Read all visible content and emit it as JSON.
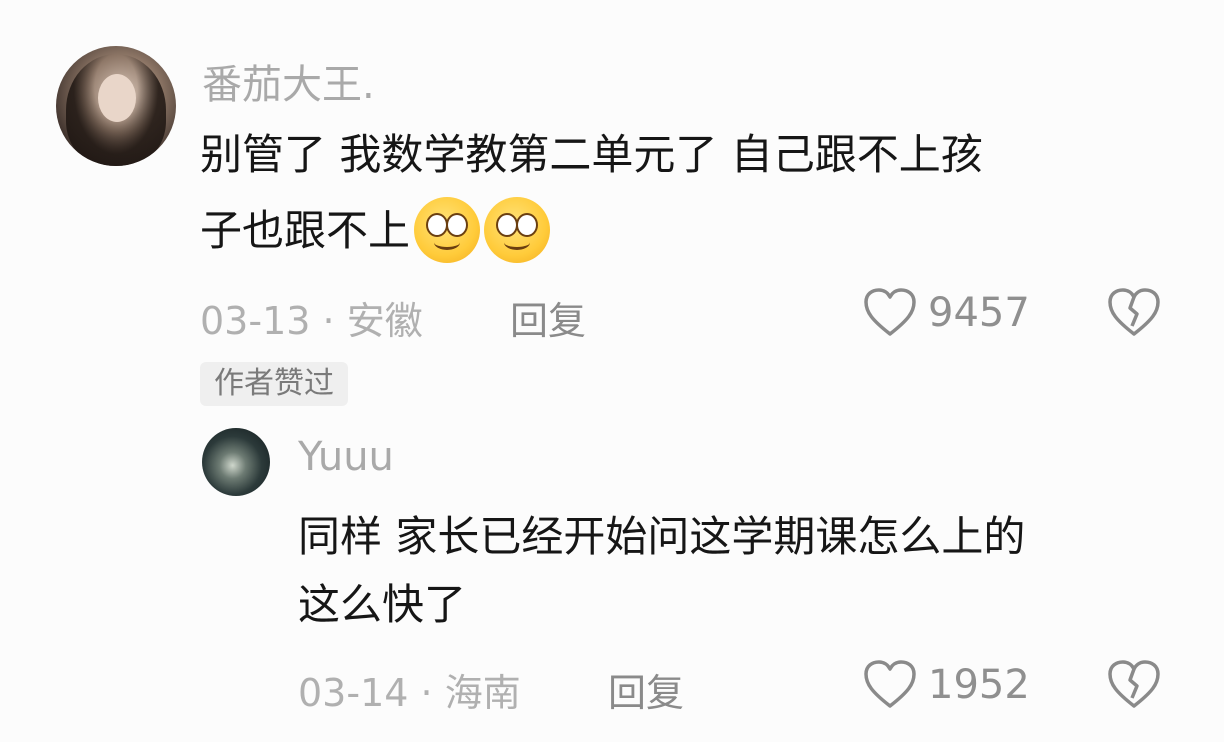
{
  "comment": {
    "username": "番茄大王.",
    "text_line1": "别管了 我数学教第二单元了 自己跟不上孩",
    "text_line2": "子也跟不上",
    "date": "03-13",
    "location": "安徽",
    "reply_label": "回复",
    "likes": "9457",
    "badge": "作者赞过"
  },
  "reply": {
    "username": "Yuuu",
    "text_line1": "同样 家长已经开始问这学期课怎么上的",
    "text_line2": "这么快了",
    "date": "03-14",
    "location": "海南",
    "reply_label": "回复",
    "likes": "1952"
  },
  "icons": {
    "like": "heart-outline-icon",
    "dislike": "broken-heart-icon",
    "emoji": "smiling-face-emoji"
  },
  "separator": "·"
}
